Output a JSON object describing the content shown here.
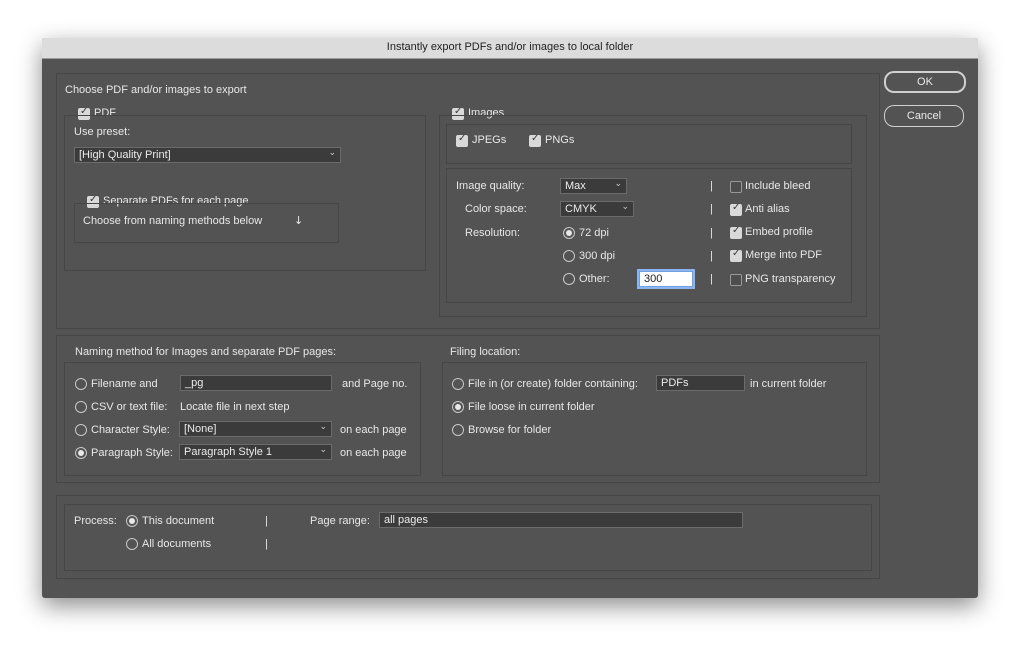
{
  "window": {
    "title": "Instantly export PDFs and/or images to local folder"
  },
  "buttons": {
    "ok": "OK",
    "cancel": "Cancel"
  },
  "export_section": {
    "heading": "Choose PDF and/or images to export",
    "pdf": {
      "label": "PDF",
      "checked": true,
      "preset_label": "Use preset:",
      "preset_value": "[High Quality Print]",
      "separate_label": "Separate PDFs for each page",
      "separate_checked": true,
      "naming_hint": "Choose from naming methods below",
      "naming_hint_icon": "↓"
    },
    "images": {
      "label": "Images",
      "checked": true,
      "jpegs_label": "JPEGs",
      "jpegs_checked": true,
      "pngs_label": "PNGs",
      "pngs_checked": true,
      "quality_label": "Image quality:",
      "quality_value": "Max",
      "colorspace_label": "Color space:",
      "colorspace_value": "CMYK",
      "resolution_label": "Resolution:",
      "res_72": "72 dpi",
      "res_300": "300 dpi",
      "res_other": "Other:",
      "res_other_value": "300",
      "separator": "|",
      "include_bleed": "Include bleed",
      "anti_alias": "Anti alias",
      "embed_profile": "Embed profile",
      "merge_pdf": "Merge into PDF",
      "png_transparency": "PNG transparency"
    }
  },
  "naming": {
    "heading": "Naming method for Images and separate PDF pages:",
    "filename_label": "Filename and",
    "filename_value": "_pg",
    "filename_suffix": "and Page no.",
    "csv_label": "CSV or text file:",
    "csv_hint": "Locate file in next step",
    "char_label": "Character Style:",
    "char_value": "[None]",
    "char_suffix": "on each page",
    "para_label": "Paragraph Style:",
    "para_value": "Paragraph Style 1",
    "para_suffix": "on each page"
  },
  "filing": {
    "heading": "Filing location:",
    "folder_label": "File in (or create) folder containing:",
    "folder_value": "PDFs",
    "folder_suffix": "in current folder",
    "loose_label": "File loose in current folder",
    "browse_label": "Browse for folder"
  },
  "process": {
    "label": "Process:",
    "this_doc": "This document",
    "all_docs": "All documents",
    "separator": "|",
    "page_range_label": "Page range:",
    "page_range_value": "all pages"
  }
}
